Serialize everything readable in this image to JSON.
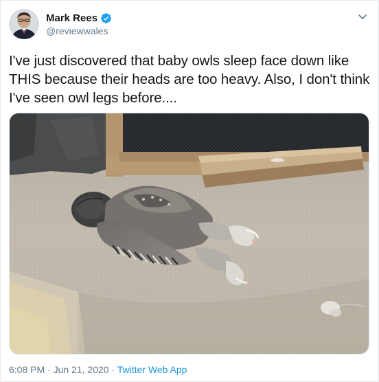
{
  "author": {
    "display_name": "Mark Rees",
    "handle": "@reviewwales",
    "verified": true
  },
  "tweet": {
    "text": "I've just discovered that baby owls sleep face down like THIS because their heads are too heavy. Also, I don't think I've seen owl legs before...."
  },
  "meta": {
    "time": "6:08 PM",
    "separator_1": " · ",
    "date": "Jun 21, 2020",
    "separator_2": " · ",
    "source": "Twitter Web App"
  },
  "icons": {
    "verified": "verified-badge-icon",
    "caret": "chevron-down-icon"
  },
  "colors": {
    "accent": "#1b95e0",
    "verified": "#1da1f2",
    "secondary_text": "#657786"
  }
}
